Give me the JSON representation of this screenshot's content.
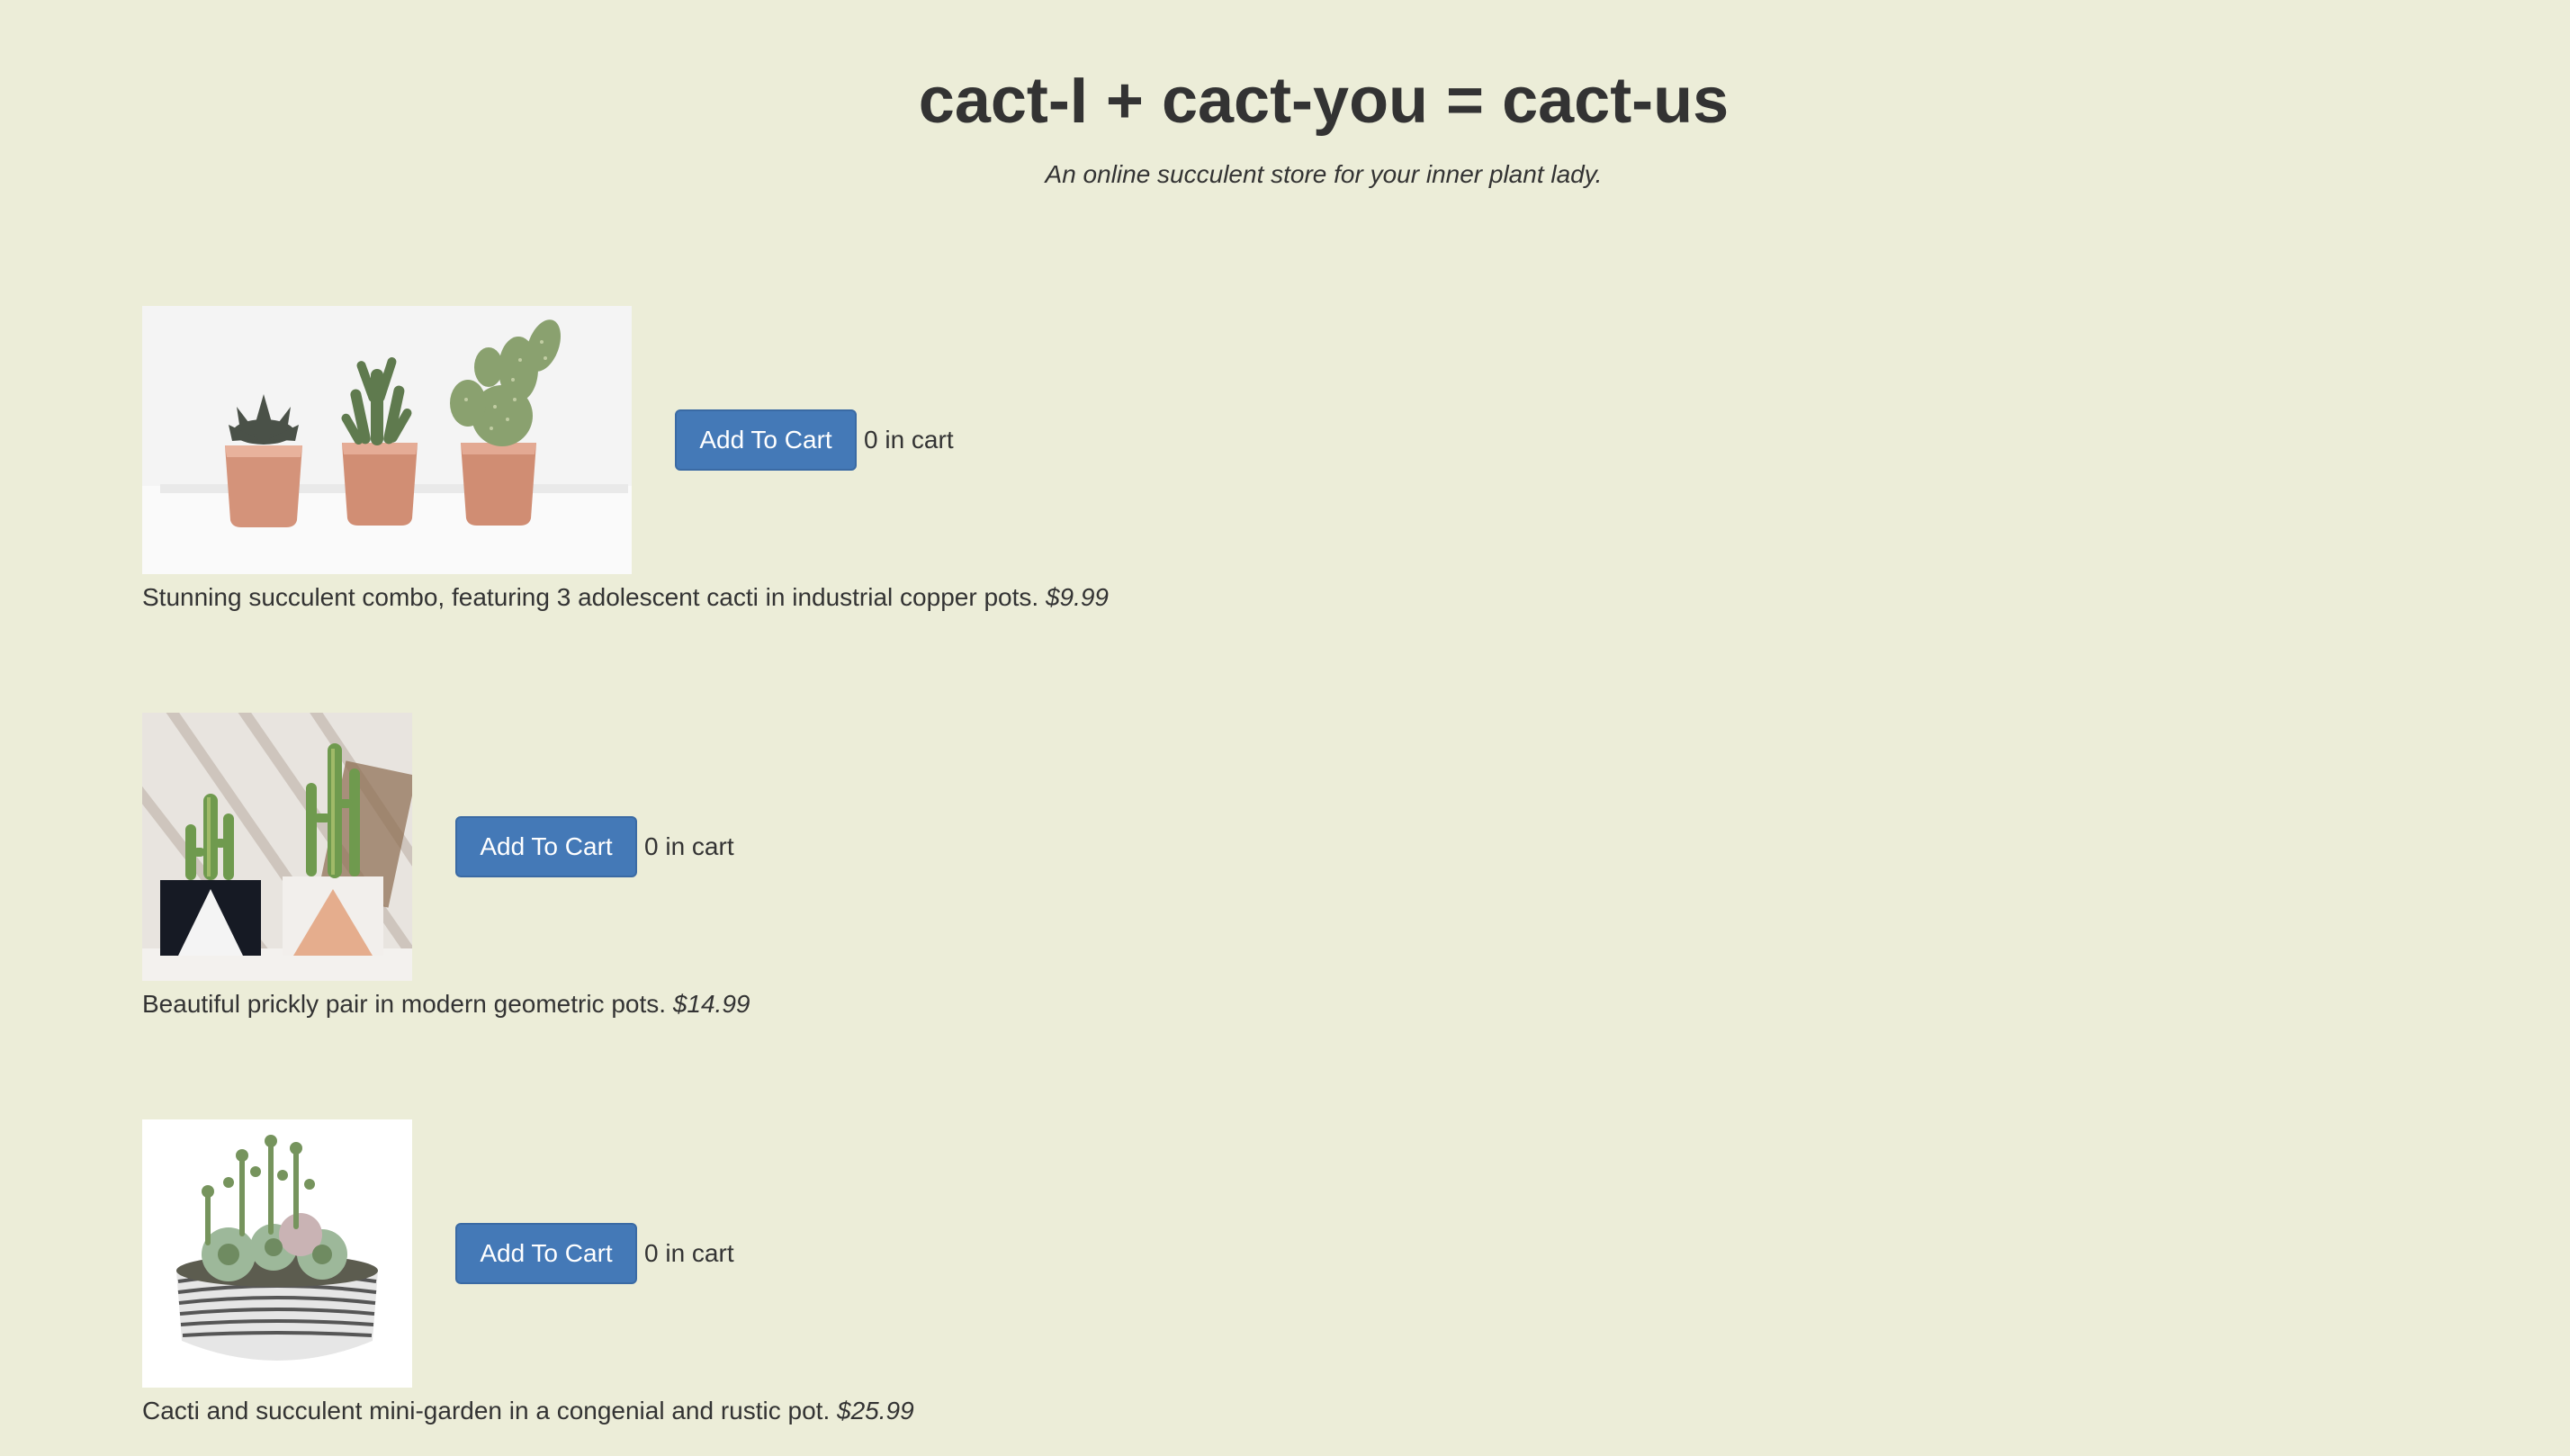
{
  "header": {
    "title": "cact-I + cact-you = cact-us",
    "tagline": "An online succulent store for your inner plant lady."
  },
  "products": [
    {
      "image_icon": "three-cacti-copper-pots-image",
      "add_label": "Add To Cart",
      "cart_count": "0 in cart",
      "description": "Stunning succulent combo, featuring 3 adolescent cacti in industrial copper pots.",
      "price": "$9.99"
    },
    {
      "image_icon": "prickly-pair-geometric-pots-image",
      "add_label": "Add To Cart",
      "cart_count": "0 in cart",
      "description": "Beautiful prickly pair in modern geometric pots.",
      "price": "$14.99"
    },
    {
      "image_icon": "succulent-mini-garden-bowl-image",
      "add_label": "Add To Cart",
      "cart_count": "0 in cart",
      "description": "Cacti and succulent mini-garden in a congenial and rustic pot.",
      "price": "$25.99"
    }
  ],
  "colors": {
    "background": "#ecedd8",
    "button": "#4479b7",
    "text": "#333333"
  }
}
